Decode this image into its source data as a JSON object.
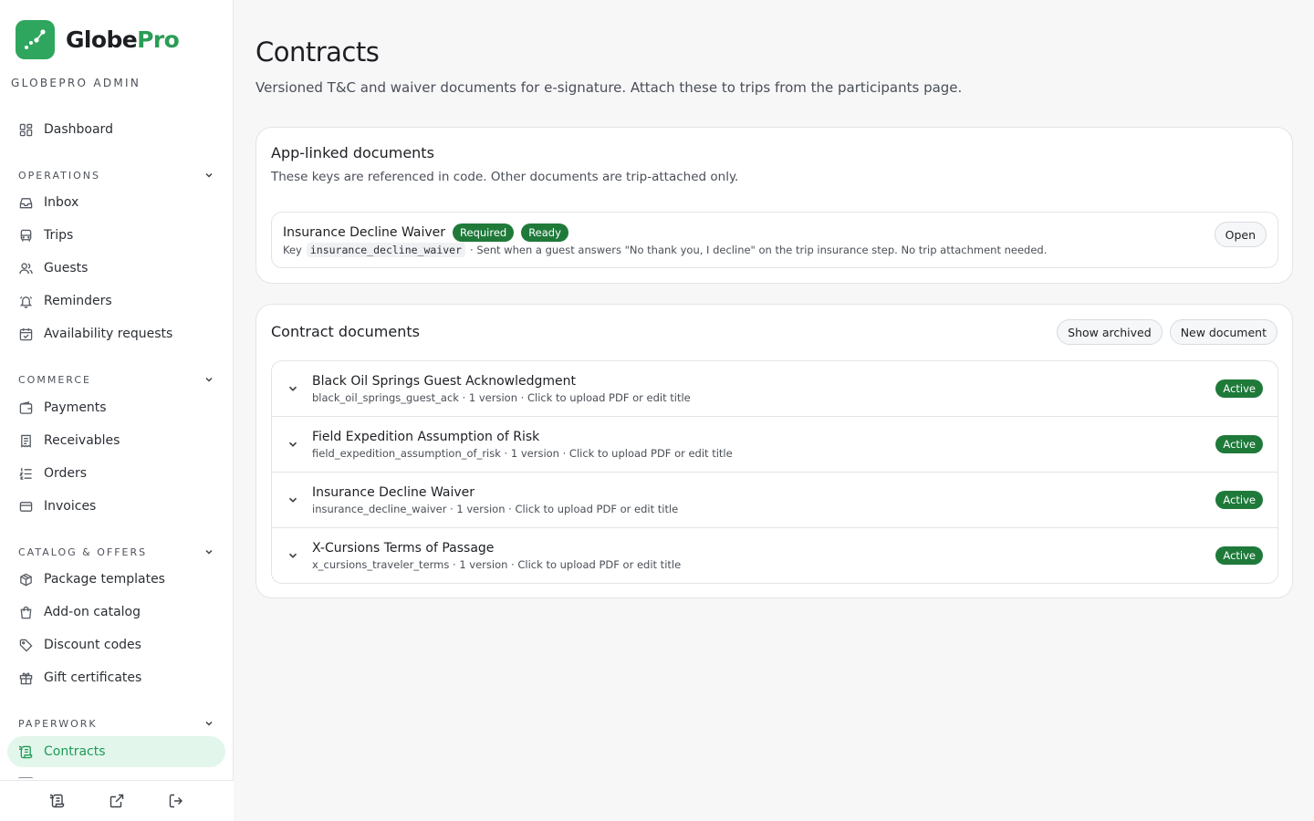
{
  "brand": {
    "name_part1": "Globe",
    "name_part2": "Pro",
    "admin_label": "GLOBEPRO ADMIN"
  },
  "sidebar": {
    "dashboard": "Dashboard",
    "sections": {
      "operations": "OPERATIONS",
      "commerce": "COMMERCE",
      "catalog": "CATALOG & OFFERS",
      "paperwork": "PAPERWORK"
    },
    "items": {
      "inbox": "Inbox",
      "trips": "Trips",
      "guests": "Guests",
      "reminders": "Reminders",
      "availability": "Availability requests",
      "payments": "Payments",
      "receivables": "Receivables",
      "orders": "Orders",
      "invoices": "Invoices",
      "package_templates": "Package templates",
      "addon_catalog": "Add-on catalog",
      "discount_codes": "Discount codes",
      "gift_certificates": "Gift certificates",
      "contracts": "Contracts"
    }
  },
  "page": {
    "title": "Contracts",
    "subtitle": "Versioned T&C and waiver documents for e-signature. Attach these to trips from the participants page."
  },
  "app_linked": {
    "title": "App-linked documents",
    "description": "These keys are referenced in code. Other documents are trip-attached only.",
    "doc": {
      "title": "Insurance Decline Waiver",
      "badge_required": "Required",
      "badge_ready": "Ready",
      "key_label": "Key",
      "key": "insurance_decline_waiver",
      "note": "· Sent when a guest answers \"No thank you, I decline\" on the trip insurance step. No trip attachment needed.",
      "open_label": "Open"
    }
  },
  "contract_docs": {
    "title": "Contract documents",
    "show_archived": "Show archived",
    "new_document": "New document",
    "rows": [
      {
        "title": "Black Oil Springs Guest Acknowledgment",
        "meta": "black_oil_springs_guest_ack · 1 version · Click to upload PDF or edit title",
        "status": "Active"
      },
      {
        "title": "Field Expedition Assumption of Risk",
        "meta": "field_expedition_assumption_of_risk · 1 version · Click to upload PDF or edit title",
        "status": "Active"
      },
      {
        "title": "Insurance Decline Waiver",
        "meta": "insurance_decline_waiver · 1 version · Click to upload PDF or edit title",
        "status": "Active"
      },
      {
        "title": "X-Cursions Terms of Passage",
        "meta": "x_cursions_traveler_terms · 1 version · Click to upload PDF or edit title",
        "status": "Active"
      }
    ]
  },
  "colors": {
    "accent": "#2fa65e",
    "badge": "#1f7a3a",
    "active_bg": "#e3f6ec"
  }
}
